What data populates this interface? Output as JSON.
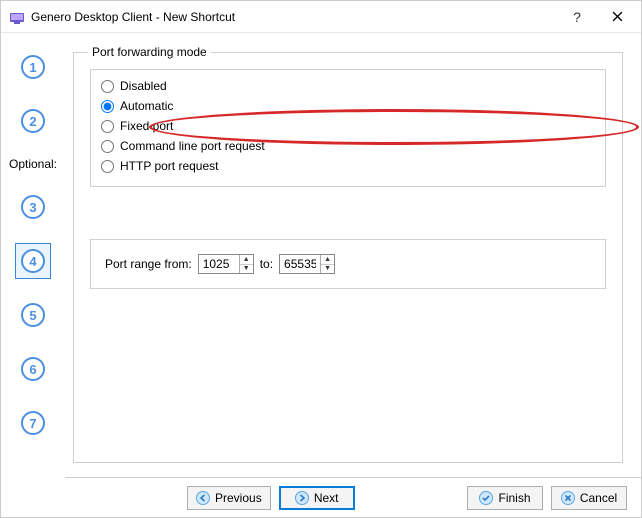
{
  "window": {
    "title": "Genero Desktop Client - New Shortcut"
  },
  "sidebar": {
    "steps": [
      "1",
      "2",
      "3",
      "4",
      "5",
      "6",
      "7"
    ],
    "optional_label": "Optional:",
    "selected_index": 3
  },
  "group": {
    "legend": "Port forwarding mode",
    "options": {
      "disabled": "Disabled",
      "automatic": "Automatic",
      "fixed": "Fixed port",
      "cmdline": "Command line port request",
      "http": "HTTP port request"
    },
    "selected": "automatic"
  },
  "range": {
    "from_label": "Port range from:",
    "to_label": "to:",
    "from_value": "1025",
    "to_value": "65535"
  },
  "buttons": {
    "previous": "Previous",
    "next": "Next",
    "finish": "Finish",
    "cancel": "Cancel"
  }
}
